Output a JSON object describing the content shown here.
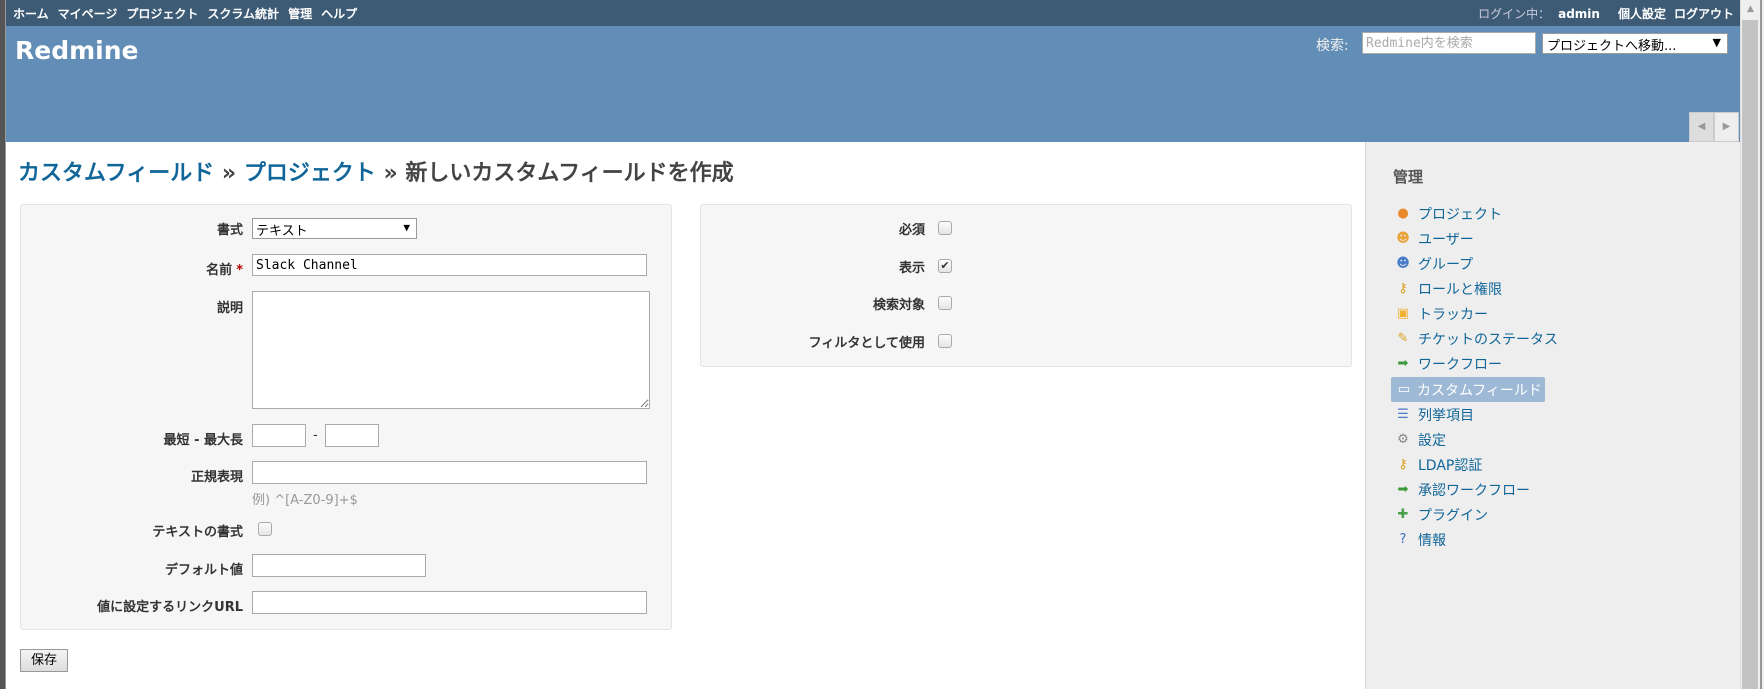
{
  "top_menu": {
    "items": [
      "ホーム",
      "マイページ",
      "プロジェクト",
      "スクラム統計",
      "管理",
      "ヘルプ"
    ],
    "logged_in_label": "ログイン中：",
    "user": "admin",
    "my_account": "個人設定",
    "logout": "ログアウト"
  },
  "header": {
    "app_title": "Redmine",
    "search_label": "検索:",
    "search_placeholder": "Redmine内を検索",
    "jump_select": "プロジェクトへ移動...",
    "tab_prev": "◀",
    "tab_next": "▶"
  },
  "page": {
    "breadcrumb_1": "カスタムフィールド",
    "separator": "»",
    "breadcrumb_2": "プロジェクト",
    "title": "新しいカスタムフィールドを作成"
  },
  "form_left": {
    "format_label": "書式",
    "format_value": "テキスト",
    "name_label": "名前",
    "required_mark": "*",
    "name_value": "Slack Channel",
    "description_label": "説明",
    "description_value": "",
    "length_label": "最短 - 最大長",
    "length_separator": "-",
    "min_length": "",
    "max_length": "",
    "regexp_label": "正規表現",
    "regexp_value": "",
    "regexp_hint": "例) ^[A-Z0-9]+$",
    "text_formatting_label": "テキストの書式",
    "text_formatting_checked": false,
    "default_value_label": "デフォルト値",
    "default_value": "",
    "url_pattern_label": "値に設定するリンクURL",
    "url_pattern": ""
  },
  "form_right": {
    "items": [
      {
        "label": "必須",
        "checked": false
      },
      {
        "label": "表示",
        "checked": true
      },
      {
        "label": "検索対象",
        "checked": false
      },
      {
        "label": "フィルタとして使用",
        "checked": false
      }
    ]
  },
  "save_button": "保存",
  "sidebar": {
    "title": "管理",
    "items": [
      {
        "label": "プロジェクト",
        "icon": "projects-icon"
      },
      {
        "label": "ユーザー",
        "icon": "user-icon"
      },
      {
        "label": "グループ",
        "icon": "group-icon"
      },
      {
        "label": "ロールと権限",
        "icon": "roles-icon"
      },
      {
        "label": "トラッカー",
        "icon": "tracker-icon"
      },
      {
        "label": "チケットのステータス",
        "icon": "issue-status-icon"
      },
      {
        "label": "ワークフロー",
        "icon": "workflow-icon"
      },
      {
        "label": "カスタムフィールド",
        "icon": "custom-fields-icon",
        "selected": true
      },
      {
        "label": "列挙項目",
        "icon": "list-icon"
      },
      {
        "label": "設定",
        "icon": "gear-icon"
      },
      {
        "label": "LDAP認証",
        "icon": "ldap-icon"
      },
      {
        "label": "承認ワークフロー",
        "icon": "workflow-icon"
      },
      {
        "label": "プラグイン",
        "icon": "plugin-icon"
      },
      {
        "label": "情報",
        "icon": "info-icon"
      }
    ]
  },
  "colors": {
    "top_menu": "#3e5b76",
    "header": "#628db6",
    "link": "#116699",
    "selected": "#9db9d5"
  }
}
